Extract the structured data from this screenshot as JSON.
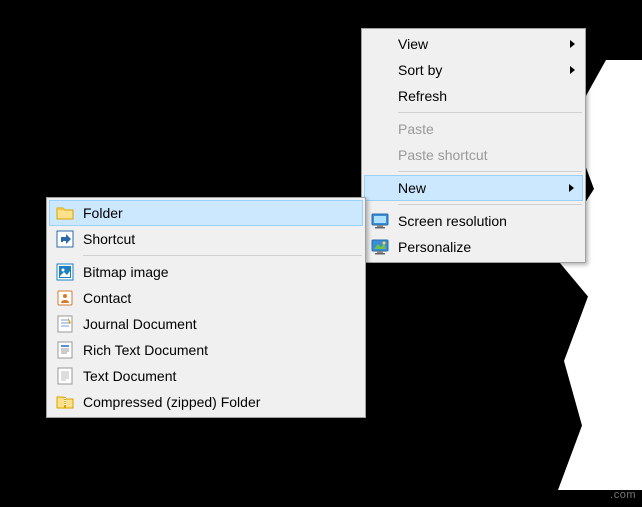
{
  "main_menu": {
    "view": "View",
    "sortby": "Sort by",
    "refresh": "Refresh",
    "paste": "Paste",
    "paste_shortcut": "Paste shortcut",
    "new": "New",
    "screen_res": "Screen resolution",
    "personalize": "Personalize"
  },
  "sub_menu": {
    "folder": "Folder",
    "shortcut": "Shortcut",
    "bitmap": "Bitmap image",
    "contact": "Contact",
    "journal": "Journal Document",
    "rtf": "Rich Text Document",
    "text": "Text Document",
    "zip": "Compressed (zipped) Folder"
  },
  "watermark": ".com"
}
